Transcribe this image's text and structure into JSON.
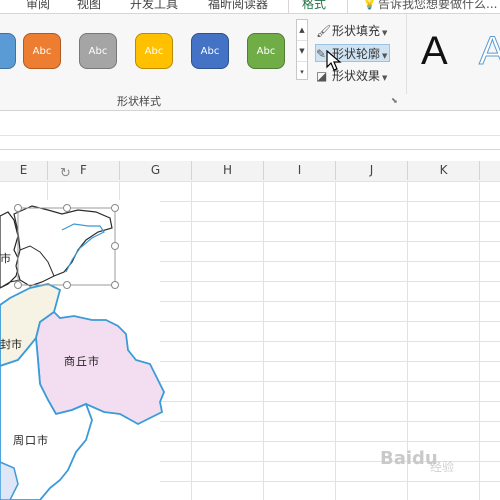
{
  "ribbon": {
    "tabs": [
      {
        "label": "审阅"
      },
      {
        "label": "视图"
      },
      {
        "label": "开发工具"
      },
      {
        "label": "福昕阅读器"
      },
      {
        "label": "格式"
      }
    ],
    "tell_me": "告诉我您想要做什么...",
    "shape_styles": [
      {
        "label": "Abc",
        "color": "#ed7d31"
      },
      {
        "label": "Abc",
        "color": "#a5a5a5"
      },
      {
        "label": "Abc",
        "color": "#ffc000"
      },
      {
        "label": "Abc",
        "color": "#4472c4"
      },
      {
        "label": "Abc",
        "color": "#70ad47"
      }
    ],
    "commands": {
      "fill": "形状填充",
      "outline": "形状轮廓",
      "effects": "形状效果"
    },
    "group_label": "形状样式",
    "wordart": [
      "A",
      "A"
    ]
  },
  "sheet": {
    "columns": [
      "E",
      "F",
      "G",
      "H",
      "I",
      "J",
      "K"
    ]
  },
  "map": {
    "labels": [
      "市",
      "封市",
      "商丘市",
      "周口市"
    ],
    "region_colors": {
      "commercial": "#f3def1",
      "pale": "#f6f3e4",
      "border": "#3a9bd8"
    }
  },
  "watermark": {
    "main": "Baidu",
    "sub": "经验"
  }
}
